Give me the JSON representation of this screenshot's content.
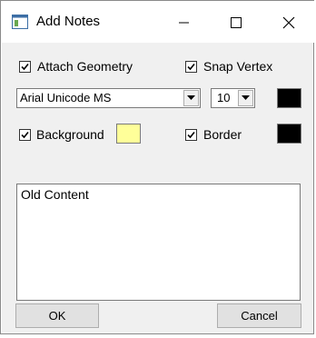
{
  "window": {
    "title": "Add Notes",
    "controls": {
      "minimize": "minimize",
      "maximize": "maximize",
      "close": "close"
    }
  },
  "options": {
    "attach_geometry": {
      "label": "Attach Geometry",
      "checked": true
    },
    "snap_vertex": {
      "label": "Snap Vertex",
      "checked": true
    },
    "background": {
      "label": "Background",
      "checked": true,
      "color": "#ffff99"
    },
    "border": {
      "label": "Border",
      "checked": true,
      "color": "#000000"
    }
  },
  "font": {
    "family": "Arial Unicode MS",
    "size": "10",
    "color": "#000000"
  },
  "content": {
    "text": "Old Content"
  },
  "buttons": {
    "ok": "OK",
    "cancel": "Cancel"
  }
}
